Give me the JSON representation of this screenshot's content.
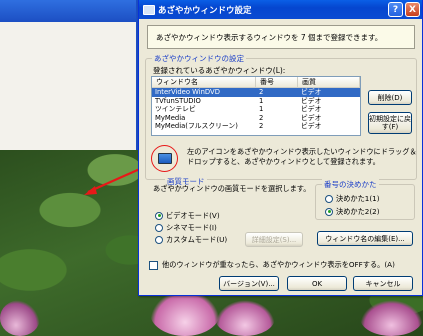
{
  "dialog": {
    "title": "あざやかウィンドウ設定",
    "help_button": "?",
    "close_button": "X",
    "info_text": "あざやかウィンドウ表示するウィンドウを 7 個まで登録できます。"
  },
  "window_section": {
    "group_title": "あざやかウィンドウの設定",
    "list_label": "登録されているあざやかウィンドウ(L):",
    "columns": [
      "ウィンドウ名",
      "番号",
      "画質"
    ],
    "rows": [
      {
        "name": "InterVideo WinDVD",
        "number": "2",
        "quality": "ビデオ",
        "selected": true
      },
      {
        "name": "TVfunSTUDIO",
        "number": "1",
        "quality": "ビデオ",
        "selected": false
      },
      {
        "name": "ツインテレビ",
        "number": "1",
        "quality": "ビデオ",
        "selected": false
      },
      {
        "name": "MyMedia",
        "number": "2",
        "quality": "ビデオ",
        "selected": false
      },
      {
        "name": "MyMedia(フルスクリーン)",
        "number": "2",
        "quality": "ビデオ",
        "selected": false
      }
    ],
    "delete_button": "削除(D)",
    "reset_button": "初期設定に戻す(F)",
    "drag_text": "左のアイコンをあざやかウィンドウ表示したいウィンドウにドラッグ＆ドロップすると、あざやかウィンドウとして登録されます。"
  },
  "mode_section": {
    "group_title": "画質モード",
    "description": "あざやかウィンドウの画質モードを選択します。",
    "options": [
      {
        "label": "ビデオモード(V)",
        "checked": true
      },
      {
        "label": "シネマモード(I)",
        "checked": false
      },
      {
        "label": "カスタムモード(U)",
        "checked": false
      }
    ],
    "detail_button": "詳細設定(S)..."
  },
  "number_section": {
    "group_title": "番号の決めかた",
    "options": [
      {
        "label": "決めかた1(1)",
        "checked": false
      },
      {
        "label": "決めかた2(2)",
        "checked": true
      }
    ],
    "edit_button": "ウィンドウ名の編集(E)..."
  },
  "footer": {
    "checkbox_label": "他のウィンドウが重なったら、あざやかウィンドウ表示をOFFする。(A)",
    "version_button": "バージョン(V)...",
    "ok_button": "OK",
    "cancel_button": "キャンセル"
  },
  "colors": {
    "titlebar": "#0546cf",
    "group_title": "#1c3fc8",
    "selection": "#316ac5"
  }
}
